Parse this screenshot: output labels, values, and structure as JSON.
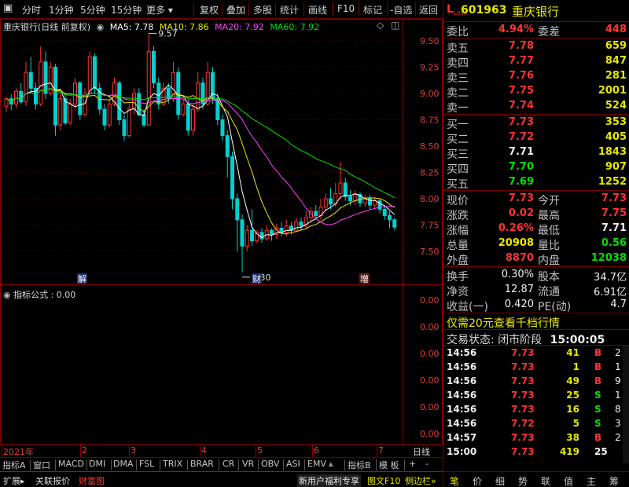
{
  "toolbar": {
    "close": "▣",
    "items": [
      "分时",
      "1分钟",
      "5分钟",
      "15分钟",
      "更多",
      "复权",
      "叠加",
      "多股",
      "统计",
      "画线",
      "F10",
      "标记",
      "-自选",
      "返回"
    ]
  },
  "legend": {
    "name": "重庆银行(日线 前复权)",
    "ma5": "MA5: 7.78",
    "ma10": "MA10: 7.86",
    "ma20": "MA20: 7.92",
    "ma60": "MA60: 7.92"
  },
  "colors": {
    "up": "#ff3232",
    "down": "#00d0d0",
    "ma5": "#ffffff",
    "ma10": "#e8e800",
    "ma20": "#ff40ff",
    "ma60": "#00e000",
    "grid": "#8a0000"
  },
  "annotations": {
    "high": "9.57",
    "low": "7.30",
    "marker_jie": "解",
    "marker_cai": "财",
    "marker_zeng": "增"
  },
  "indicator": {
    "title": "指标公式 : 0.00",
    "axis": [
      "0.00",
      "0.00",
      "0.00",
      "0.00",
      "0.00",
      "0.00",
      "0.00",
      "0.00"
    ]
  },
  "chart_data": {
    "type": "candlestick",
    "title": "重庆银行(日线 前复权)",
    "ylim": [
      7.3,
      9.6
    ],
    "yticks": [
      7.5,
      7.75,
      8.0,
      8.25,
      8.5,
      8.75,
      9.0,
      9.25,
      9.5
    ],
    "xlabels": [
      "2021年",
      "2",
      "3",
      "4",
      "5",
      "6",
      "7"
    ],
    "high_label": "9.57",
    "low_label": "7.30",
    "candles": [
      [
        8.88,
        8.95,
        8.82,
        8.97
      ],
      [
        8.95,
        8.9,
        8.84,
        8.99
      ],
      [
        8.9,
        9.02,
        8.86,
        9.05
      ],
      [
        9.02,
        8.92,
        8.9,
        9.1
      ],
      [
        8.92,
        9.2,
        8.88,
        9.3
      ],
      [
        9.2,
        9.05,
        9.0,
        9.35
      ],
      [
        9.05,
        8.9,
        8.85,
        9.1
      ],
      [
        8.9,
        9.3,
        8.88,
        9.45
      ],
      [
        9.3,
        9.0,
        8.95,
        9.4
      ],
      [
        9.0,
        9.25,
        8.98,
        9.3
      ],
      [
        9.25,
        8.7,
        8.6,
        9.28
      ],
      [
        8.7,
        8.95,
        8.65,
        9.0
      ],
      [
        8.95,
        8.72,
        8.7,
        9.0
      ],
      [
        8.72,
        8.9,
        8.7,
        8.95
      ],
      [
        8.9,
        9.1,
        8.85,
        9.15
      ],
      [
        9.1,
        8.8,
        8.75,
        9.12
      ],
      [
        8.8,
        9.0,
        8.78,
        9.05
      ],
      [
        9.0,
        9.35,
        8.98,
        9.4
      ],
      [
        9.35,
        9.05,
        9.0,
        9.38
      ],
      [
        9.05,
        8.85,
        8.8,
        9.1
      ],
      [
        8.85,
        8.7,
        8.65,
        8.9
      ],
      [
        8.7,
        8.9,
        8.68,
        8.95
      ],
      [
        8.9,
        9.1,
        8.88,
        9.15
      ],
      [
        9.1,
        8.75,
        8.7,
        9.12
      ],
      [
        8.75,
        8.6,
        8.55,
        8.8
      ],
      [
        8.6,
        8.85,
        8.58,
        8.9
      ],
      [
        8.85,
        9.0,
        8.8,
        9.05
      ],
      [
        9.0,
        8.8,
        8.78,
        9.05
      ],
      [
        8.8,
        8.7,
        8.68,
        8.85
      ],
      [
        8.7,
        9.4,
        8.7,
        9.57
      ],
      [
        9.4,
        9.1,
        9.05,
        9.45
      ],
      [
        9.1,
        8.9,
        8.85,
        9.15
      ],
      [
        8.9,
        9.05,
        8.88,
        9.1
      ],
      [
        9.05,
        8.95,
        8.9,
        9.1
      ],
      [
        8.95,
        9.2,
        8.92,
        9.3
      ],
      [
        9.2,
        8.8,
        8.75,
        9.25
      ],
      [
        8.8,
        8.9,
        8.78,
        8.95
      ],
      [
        8.9,
        8.65,
        8.6,
        8.95
      ],
      [
        8.65,
        8.85,
        8.6,
        8.9
      ],
      [
        8.85,
        9.1,
        8.82,
        9.2
      ],
      [
        9.1,
        8.9,
        8.85,
        9.15
      ],
      [
        8.9,
        9.2,
        8.88,
        9.3
      ],
      [
        9.2,
        8.95,
        8.9,
        9.25
      ],
      [
        8.95,
        8.75,
        8.7,
        9.0
      ],
      [
        8.75,
        8.6,
        8.55,
        8.8
      ],
      [
        8.6,
        8.4,
        8.2,
        8.65
      ],
      [
        8.4,
        8.0,
        7.9,
        8.45
      ],
      [
        8.0,
        7.8,
        7.5,
        8.05
      ],
      [
        7.8,
        7.55,
        7.3,
        7.85
      ],
      [
        7.55,
        7.7,
        7.5,
        7.75
      ],
      [
        7.7,
        7.6,
        7.55,
        7.9
      ],
      [
        7.6,
        7.68,
        7.58,
        7.7
      ],
      [
        7.68,
        7.62,
        7.58,
        7.72
      ],
      [
        7.62,
        7.7,
        7.6,
        7.75
      ],
      [
        7.7,
        7.66,
        7.6,
        7.72
      ],
      [
        7.66,
        7.72,
        7.62,
        7.76
      ],
      [
        7.72,
        7.68,
        7.64,
        7.78
      ],
      [
        7.68,
        7.74,
        7.64,
        7.8
      ],
      [
        7.74,
        7.7,
        7.66,
        7.78
      ],
      [
        7.7,
        7.78,
        7.68,
        7.82
      ],
      [
        7.78,
        7.74,
        7.7,
        7.82
      ],
      [
        7.74,
        7.82,
        7.72,
        7.88
      ],
      [
        7.82,
        7.88,
        7.78,
        7.92
      ],
      [
        7.88,
        7.84,
        7.8,
        7.94
      ],
      [
        7.84,
        7.92,
        7.8,
        8.0
      ],
      [
        7.92,
        8.0,
        7.88,
        8.05
      ],
      [
        8.0,
        7.95,
        7.9,
        8.1
      ],
      [
        7.95,
        8.05,
        7.92,
        8.15
      ],
      [
        8.05,
        8.15,
        8.0,
        8.35
      ],
      [
        8.15,
        8.02,
        7.98,
        8.2
      ],
      [
        8.02,
        7.98,
        7.94,
        8.08
      ],
      [
        7.98,
        8.04,
        7.94,
        8.08
      ],
      [
        8.04,
        7.96,
        7.92,
        8.06
      ],
      [
        7.96,
        8.0,
        7.92,
        8.04
      ],
      [
        8.0,
        7.94,
        7.9,
        8.04
      ],
      [
        7.94,
        7.98,
        7.9,
        8.02
      ],
      [
        7.98,
        7.9,
        7.86,
        8.0
      ],
      [
        7.9,
        7.84,
        7.8,
        7.94
      ],
      [
        7.84,
        7.8,
        7.72,
        7.88
      ],
      [
        7.8,
        7.73,
        7.7,
        7.82
      ]
    ]
  },
  "stock": {
    "prefix": "L",
    "small": "L000",
    "code": "601963",
    "name": "重庆银行"
  },
  "weibi": {
    "label1": "委比",
    "val1": "4.94%",
    "label2": "委差",
    "val2": "448"
  },
  "sell": [
    {
      "label": "卖五",
      "price": "7.78",
      "vol": "659"
    },
    {
      "label": "卖四",
      "price": "7.77",
      "vol": "847"
    },
    {
      "label": "卖三",
      "price": "7.76",
      "vol": "281"
    },
    {
      "label": "卖二",
      "price": "7.75",
      "vol": "2001"
    },
    {
      "label": "卖一",
      "price": "7.74",
      "vol": "524"
    }
  ],
  "buy": [
    {
      "label": "买一",
      "price": "7.73",
      "vol": "353",
      "color": "red"
    },
    {
      "label": "买二",
      "price": "7.72",
      "vol": "405",
      "color": "red"
    },
    {
      "label": "买三",
      "price": "7.71",
      "vol": "1843",
      "color": "white"
    },
    {
      "label": "买四",
      "price": "7.70",
      "vol": "907",
      "color": "green"
    },
    {
      "label": "买五",
      "price": "7.69",
      "vol": "1252",
      "color": "green"
    }
  ],
  "quote": [
    {
      "l1": "现价",
      "v1": "7.73",
      "c1": "red",
      "l2": "今开",
      "v2": "7.73",
      "c2": "red"
    },
    {
      "l1": "涨跌",
      "v1": "0.02",
      "c1": "red",
      "l2": "最高",
      "v2": "7.75",
      "c2": "red"
    },
    {
      "l1": "涨幅",
      "v1": "0.26%",
      "c1": "red",
      "l2": "最低",
      "v2": "7.71",
      "c2": "white"
    },
    {
      "l1": "总量",
      "v1": "20908",
      "c1": "yellow",
      "l2": "量比",
      "v2": "0.56",
      "c2": "green"
    },
    {
      "l1": "外盘",
      "v1": "8870",
      "c1": "red",
      "l2": "内盘",
      "v2": "12038",
      "c2": "green"
    }
  ],
  "stats": [
    {
      "l1": "换手",
      "v1": "0.30%",
      "l2": "股本",
      "v2": "34.7亿"
    },
    {
      "l1": "净资",
      "v1": "12.87",
      "l2": "流通",
      "v2": "6.91亿"
    },
    {
      "l1": "收益(一)",
      "v1": "0.420",
      "l2": "PE(动)",
      "v2": "4.7"
    }
  ],
  "promo": "仅需20元查看千档行情",
  "status_label": "交易状态: 闭市阶段",
  "status_time": "15:00:05",
  "trades": [
    {
      "t": "14:56",
      "p": "7.73",
      "v": "41",
      "s": "B"
    },
    {
      "t": "14:56",
      "p": "7.73",
      "v": "1",
      "s": "B"
    },
    {
      "t": "14:56",
      "p": "7.73",
      "v": "49",
      "s": "B"
    },
    {
      "t": "14:56",
      "p": "7.73",
      "v": "25",
      "s": "S"
    },
    {
      "t": "14:56",
      "p": "7.73",
      "v": "16",
      "s": "S"
    },
    {
      "t": "14:56",
      "p": "7.72",
      "v": "5",
      "s": "S"
    },
    {
      "t": "14:57",
      "p": "7.73",
      "v": "38",
      "s": "B"
    },
    {
      "t": "15:00",
      "p": "7.73",
      "v": "419",
      "s": "25"
    }
  ],
  "trade_counts": [
    "2",
    "1",
    "9",
    "1",
    "8",
    "3",
    "2"
  ],
  "tabs1": [
    "指标A",
    "窗口",
    "MACD",
    "DMI",
    "DMA",
    "FSL",
    "TRIX",
    "BRAR",
    "CR",
    "VR",
    "OBV",
    "ASI",
    "EMV",
    "指标B",
    "模 板",
    "+",
    "-",
    "日线"
  ],
  "tabs2": [
    "扩展",
    "关联报价",
    "财富图",
    "新用户福利专享",
    "图文F10",
    "侧边栏"
  ],
  "right_bottom_tabs": [
    "笔",
    "价",
    "细",
    "势",
    "联",
    "值",
    "主",
    "筹"
  ]
}
